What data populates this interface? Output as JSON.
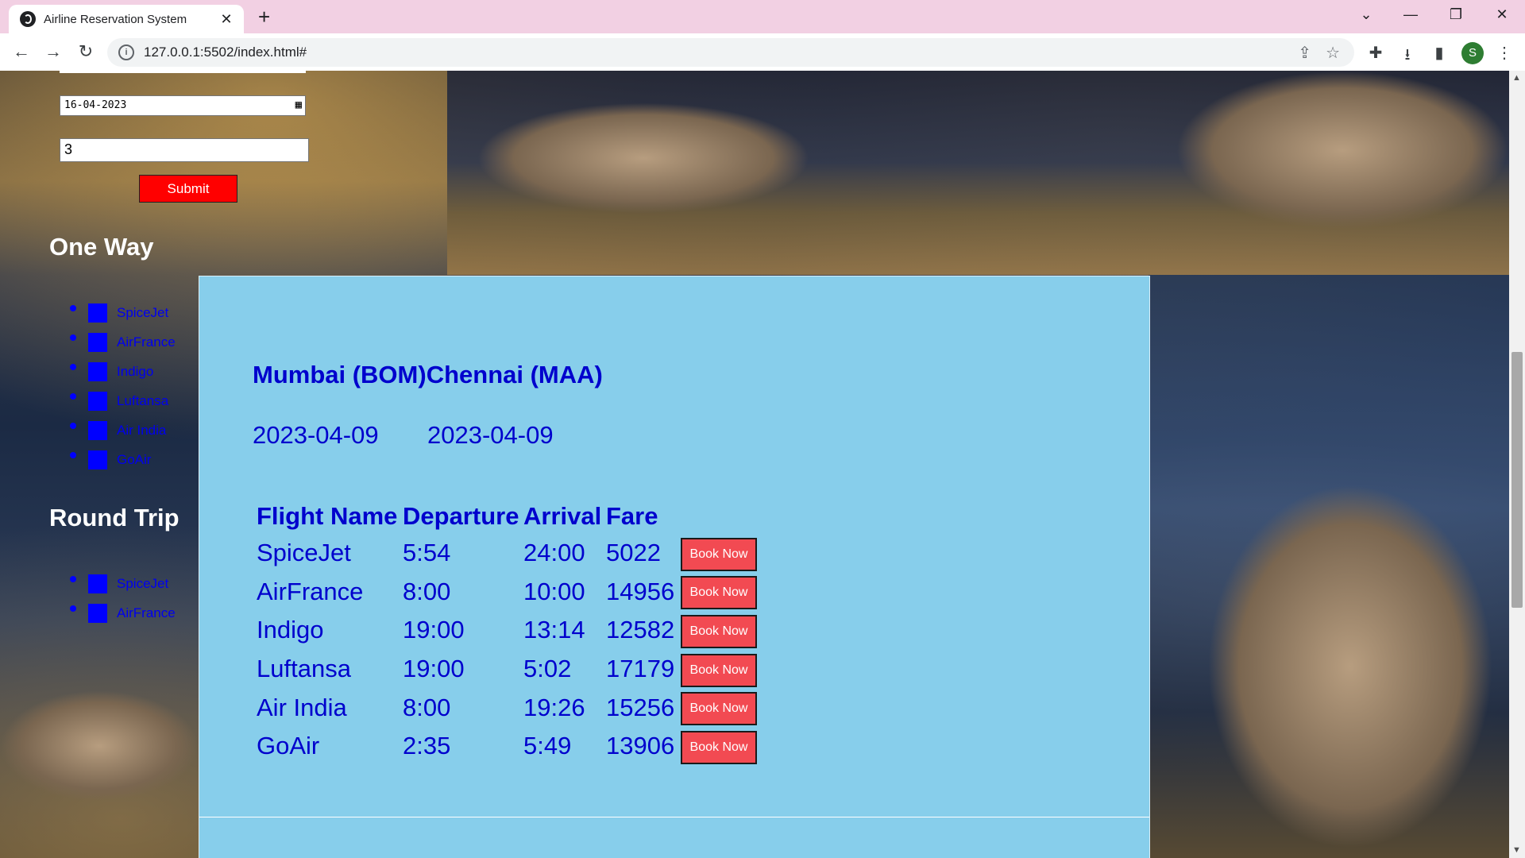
{
  "browser": {
    "tab_title": "Airline Reservation System",
    "tab_close": "✕",
    "new_tab": "+",
    "url": "127.0.0.1:5502/index.html#",
    "profile_initial": "S",
    "controls": {
      "tab_search": "⌄",
      "minimize": "—",
      "restore": "❐",
      "close": "✕"
    },
    "nav": {
      "back": "←",
      "forward": "→",
      "reload": "↻"
    },
    "icons": {
      "share": "⇪",
      "star": "☆",
      "extensions": "✚",
      "download": "⭳",
      "sidepanel": "▮",
      "menu": "⋮"
    }
  },
  "sidebar": {
    "date_value": "16-04-2023",
    "passengers_value": "3",
    "submit_label": "Submit",
    "one_way_heading": "One Way",
    "one_way_items": [
      {
        "label": "SpiceJet"
      },
      {
        "label": "AirFrance"
      },
      {
        "label": "Indigo"
      },
      {
        "label": "Luftansa"
      },
      {
        "label": "Air India"
      },
      {
        "label": "GoAir"
      }
    ],
    "round_trip_heading": "Round Trip",
    "round_trip_items": [
      {
        "label": "SpiceJet"
      },
      {
        "label": "AirFrance"
      }
    ]
  },
  "results": {
    "route": "Mumbai (BOM)Chennai (MAA)",
    "date_from": "2023-04-09",
    "date_to": "2023-04-09",
    "headers": {
      "name": "Flight Name",
      "departure": "Departure",
      "arrival": "Arrival",
      "fare": "Fare"
    },
    "book_label": "Book Now",
    "rows": [
      {
        "name": "SpiceJet",
        "departure": "5:54",
        "arrival": "24:00",
        "fare": "5022"
      },
      {
        "name": "AirFrance",
        "departure": "8:00",
        "arrival": "10:00",
        "fare": "14956"
      },
      {
        "name": "Indigo",
        "departure": "19:00",
        "arrival": "13:14",
        "fare": "12582"
      },
      {
        "name": "Luftansa",
        "departure": "19:00",
        "arrival": "5:02",
        "fare": "17179"
      },
      {
        "name": "Air India",
        "departure": "8:00",
        "arrival": "19:26",
        "fare": "15256"
      },
      {
        "name": "GoAir",
        "departure": "2:35",
        "arrival": "5:49",
        "fare": "13906"
      }
    ]
  },
  "colors": {
    "panel": "#87ceeb",
    "text_blue": "#0000cd",
    "submit": "#ff0000",
    "book_button": "#f24a52"
  }
}
